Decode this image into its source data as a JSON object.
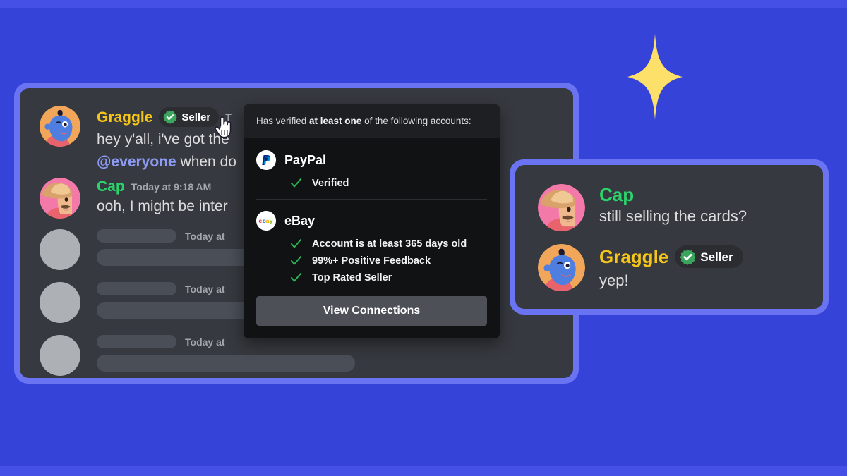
{
  "theme": {
    "background": "#3643D9",
    "band": "#4450E6",
    "card_border": "#6A74F2",
    "panel": "#36393F",
    "tooltip_bg": "#111214",
    "tooltip_header_bg": "#1E1F22",
    "accent_yellow": "#F5C518",
    "accent_green": "#2BD46B",
    "sparkle": "#FCE06A",
    "mention": "#8D9BF5"
  },
  "sparkle": {
    "icon": "sparkle-star-icon"
  },
  "chat": {
    "messages": [
      {
        "author": "Graggle",
        "author_color": "#F5C518",
        "avatar": "graggle-genie-avatar",
        "badge": {
          "label": "Seller",
          "icon": "verified-check-icon"
        },
        "timestamp": "T",
        "text_line_1": "hey y'all, i've got the",
        "mention": "@everyone",
        "text_line_2": " when do"
      },
      {
        "author": "Cap",
        "author_color": "#2BD46B",
        "avatar": "cap-hat-avatar",
        "timestamp": "Today at 9:18 AM",
        "text_line_1": "ooh, I might be inter"
      }
    ],
    "skeleton_rows": [
      {
        "timestamp": "Today at"
      },
      {
        "timestamp": "Today at"
      },
      {
        "timestamp": "Today at"
      }
    ]
  },
  "tooltip": {
    "header_prefix": "Has verified ",
    "header_bold": "at least one",
    "header_suffix": " of the following accounts:",
    "connections": [
      {
        "name": "PayPal",
        "logo": "paypal-logo-icon",
        "items": [
          {
            "label": "Verified",
            "icon": "green-check-icon"
          }
        ]
      },
      {
        "name": "eBay",
        "logo": "ebay-logo-icon",
        "items": [
          {
            "label": "Account is at least 365 days old",
            "icon": "green-check-icon"
          },
          {
            "label": "99%+ Positive Feedback",
            "icon": "green-check-icon"
          },
          {
            "label": "Top Rated Seller",
            "icon": "green-check-icon"
          }
        ]
      }
    ],
    "footer_button": "View Connections"
  },
  "cursor": {
    "icon": "pointing-hand-cursor"
  },
  "right_card": {
    "messages": [
      {
        "author": "Cap",
        "author_color": "#2BD46B",
        "avatar": "cap-hat-avatar",
        "text": "still selling the cards?"
      },
      {
        "author": "Graggle",
        "author_color": "#F5C518",
        "avatar": "graggle-genie-avatar",
        "badge": {
          "label": "Seller",
          "icon": "verified-check-icon"
        },
        "text": "yep!"
      }
    ]
  }
}
